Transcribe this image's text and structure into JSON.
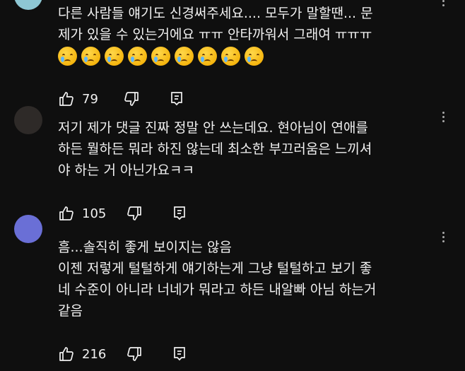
{
  "comments": [
    {
      "text": "다른 사람들 얘기도 신경써주세요.... 모두가 말할땐... 문\n제가 있을 수 있는거에요 ㅠㅠ 안타까워서 그래여 ㅠㅠㅠ",
      "emoji_count": 9,
      "likes": "79",
      "avatar_color": "#8ec7d4"
    },
    {
      "text": "저기 제가 댓글 진짜 정말 안 쓰는데요. 현아님이 연애를\n하든 뭘하든 뭐라 하진 않는데 최소한 부끄러움은 느끼셔\n야 하는 거 아닌가요ㅋㅋ",
      "likes": "105",
      "avatar_color": "#3a3a3a"
    },
    {
      "text": "흠...솔직히 좋게 보이지는 않음\n이젠 저렇게 털털하게 얘기하는게 그냥 털털하고 보기 좋\n네 수준이 아니라 너네가 뭐라고 하든 내알빠 아님 하는거\n같음",
      "likes": "216",
      "avatar_color": "#6a6fd6"
    }
  ],
  "icons": {
    "like": "thumbs-up-icon",
    "dislike": "thumbs-down-icon",
    "reply": "reply-comment-icon",
    "more": "more-vertical-icon",
    "emoji": "crying-face-emoji"
  },
  "colors": {
    "background": "#0f0f0f",
    "text": "#f1f1f1"
  }
}
